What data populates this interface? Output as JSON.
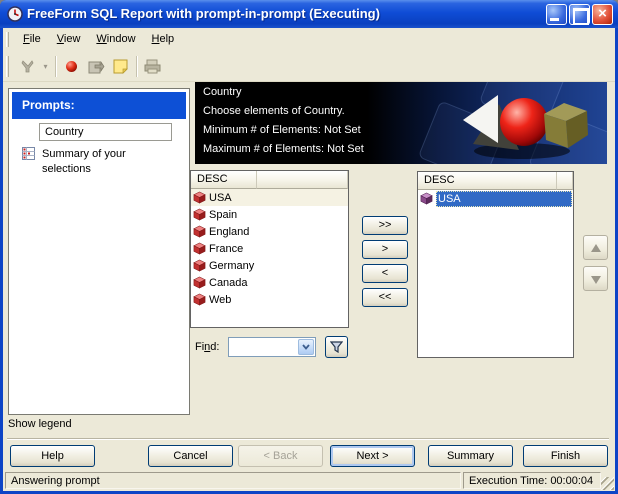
{
  "window": {
    "title": "FreeForm SQL Report with prompt-in-prompt (Executing)",
    "icon": "clock-icon"
  },
  "menu": {
    "items": [
      "File",
      "View",
      "Window",
      "Help"
    ]
  },
  "toolbar": {
    "icons": [
      "gray-figure-icon",
      "red-ball-icon",
      "send-export-icon",
      "sticky-note-icon",
      "printer-icon"
    ]
  },
  "prompts": {
    "header": "Prompts:",
    "current": "Country",
    "summary": "Summary of your selections",
    "show_legend": "Show legend"
  },
  "banner": {
    "title": "Country",
    "subtitle": "Choose elements of Country.",
    "min": "Minimum # of Elements: Not Set",
    "max": "Maximum # of Elements: Not Set"
  },
  "available": {
    "header": "DESC",
    "items": [
      "USA",
      "Spain",
      "England",
      "France",
      "Germany",
      "Canada",
      "Web"
    ],
    "highlighted": "USA",
    "item_icon": "red-cube-icon"
  },
  "selected": {
    "header": "DESC",
    "items": [
      "USA"
    ],
    "selected": "USA",
    "item_icon": "purple-cube-icon"
  },
  "transfer": {
    "move_all_right": ">>",
    "move_right": ">",
    "move_left": "<",
    "move_all_left": "<<"
  },
  "find": {
    "label": "Find:",
    "value": ""
  },
  "footer": {
    "help": "Help",
    "cancel": "Cancel",
    "back": "< Back",
    "next": "Next >",
    "summary": "Summary",
    "finish": "Finish"
  },
  "status": {
    "message": "Answering prompt",
    "execution_time": "Execution Time: 00:00:04"
  },
  "colors": {
    "dialog_bg": "#ece9d8",
    "titlebar_blue": "#0f4cd6",
    "prompts_header_blue": "#0d50d6",
    "selection_blue": "#316ac5",
    "banner_black": "#000000"
  }
}
